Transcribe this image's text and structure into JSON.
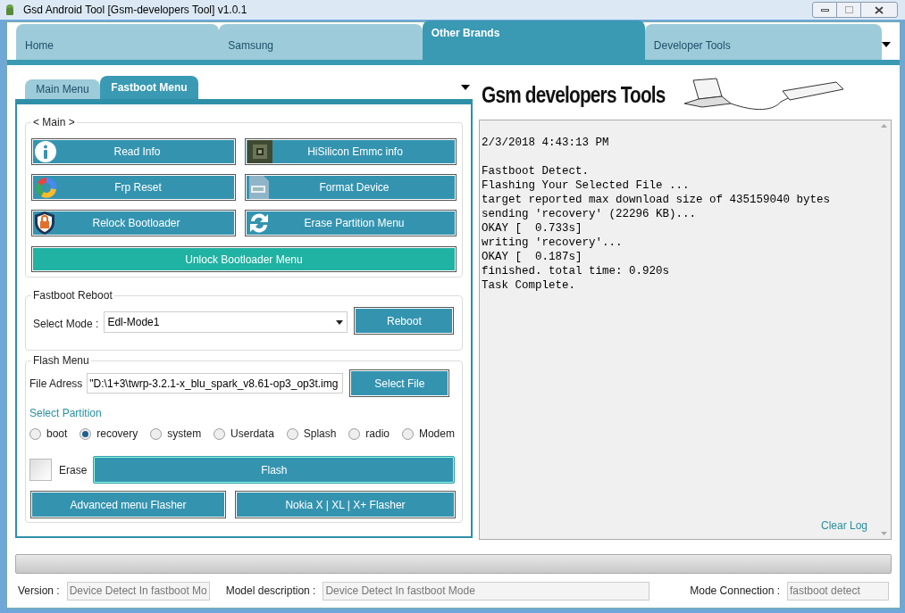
{
  "window": {
    "title": "Gsd Android Tool [Gsm-developers Tool] v1.0.1"
  },
  "main_tabs": [
    {
      "label": "Home",
      "selected": false
    },
    {
      "label": "Samsung",
      "selected": false
    },
    {
      "label": "Other Brands",
      "selected": true
    },
    {
      "label": "Developer Tools",
      "selected": false
    }
  ],
  "sub_tabs": [
    {
      "label": "Main Menu",
      "selected": false
    },
    {
      "label": "Fastboot Menu",
      "selected": true
    }
  ],
  "main_group": {
    "title": "< Main >",
    "buttons": [
      {
        "label": "Read Info",
        "kind": "info"
      },
      {
        "label": "HiSilicon Emmc info",
        "kind": "chip"
      },
      {
        "label": "Frp Reset",
        "kind": "ring"
      },
      {
        "label": "Format Device",
        "kind": "doc"
      },
      {
        "label": "Relock Bootloader",
        "kind": "shield"
      },
      {
        "label": "Erase Partition Menu",
        "kind": "refresh"
      }
    ],
    "wide_button": "Unlock Bootloader Menu"
  },
  "fastboot_reboot": {
    "title": "Fastboot Reboot",
    "mode_label": "Select Mode :",
    "mode_value": "Edl-Mode1",
    "button": "Reboot"
  },
  "flash_menu": {
    "title": "Flash Menu",
    "file_label": "File Adress",
    "file_value": "\"D:\\1+3\\twrp-3.2.1-x_blu_spark_v8.61-op3_op3t.img",
    "button": "Select File",
    "partition_label": "Select Partition",
    "partitions": [
      {
        "label": "boot",
        "selected": false
      },
      {
        "label": "recovery",
        "selected": true
      },
      {
        "label": "system",
        "selected": false
      },
      {
        "label": "Userdata",
        "selected": false
      },
      {
        "label": "Splash",
        "selected": false
      },
      {
        "label": "radio",
        "selected": false
      },
      {
        "label": "Modem",
        "selected": false
      }
    ],
    "erase": {
      "label": "Erase",
      "checked": false
    },
    "flash_button": "Flash",
    "buttons": [
      "Advanced menu Flasher",
      "Nokia X | XL | X+ Flasher"
    ]
  },
  "brand": {
    "title": "Gsm developers Tools"
  },
  "log": {
    "groups": [
      [
        "2/3/2018 4:43:13 PM"
      ],
      [
        "Fastboot Detect.",
        "Flashing Your Selected File ...",
        "target reported max download size of 435159040 bytes",
        "sending 'recovery' (22296 KB)...",
        "OKAY [  0.733s]",
        "writing 'recovery'...",
        "OKAY [  0.187s]",
        "finished. total time: 0.920s",
        "Task Complete."
      ]
    ],
    "clear_label": "Clear Log"
  },
  "progress": {
    "level": 0
  },
  "status": [
    {
      "label": "Version :",
      "value": "Device Detect In fastboot Mo"
    },
    {
      "label": "Model description :",
      "value": "Device Detect In fastboot Mode"
    },
    {
      "label": "Mode Connection :",
      "value": "fastboot detect"
    }
  ]
}
